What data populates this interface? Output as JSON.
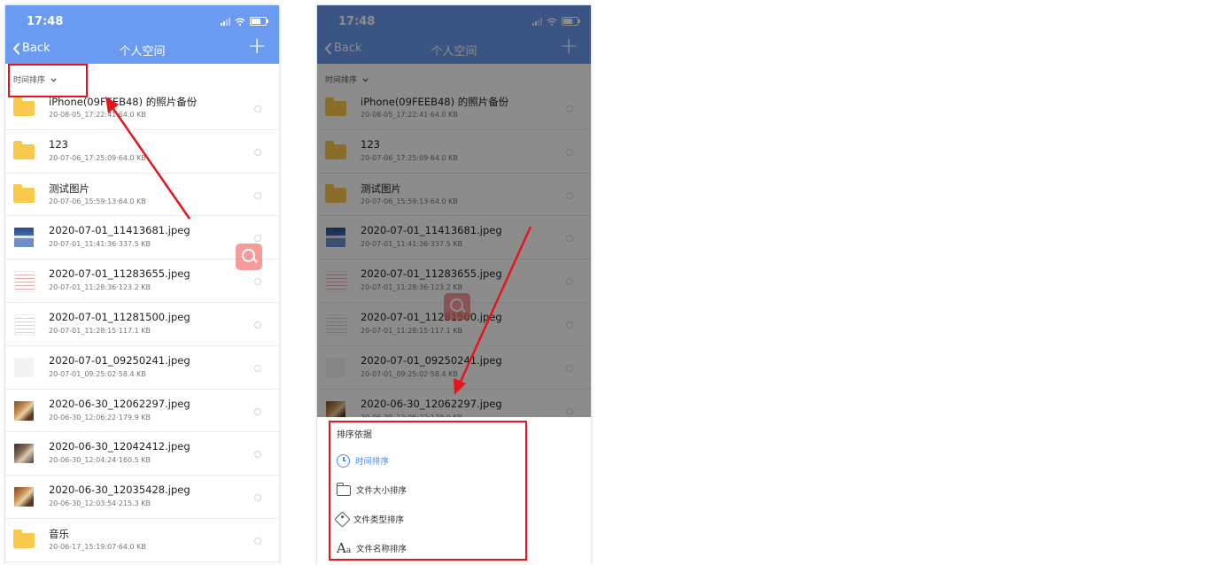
{
  "status": {
    "time": "17:48"
  },
  "nav": {
    "back": "Back",
    "title": "个人空间",
    "add": "+"
  },
  "sort_label": "时间排序",
  "files": [
    {
      "name": "iPhone(09FEEB48) 的照片备份",
      "meta": "20-08-05_17:22:41·64.0 KB",
      "icon": "folder-icon",
      "thumb": "folder"
    },
    {
      "name": "123",
      "meta": "20-07-06_17:25:09·64.0 KB",
      "icon": "folder-icon",
      "thumb": "folder"
    },
    {
      "name": "测试图片",
      "meta": "20-07-06_15:59:13·64.0 KB",
      "icon": "folder-icon",
      "thumb": "folder"
    },
    {
      "name": "2020-07-01_11413681.jpeg",
      "meta": "20-07-01_11:41:36·337.5 KB",
      "icon": "image-thumbnail",
      "thumb": "screen"
    },
    {
      "name": "2020-07-01_11283655.jpeg",
      "meta": "20-07-01_11:28:36·123.2 KB",
      "icon": "image-thumbnail",
      "thumb": "doc-red"
    },
    {
      "name": "2020-07-01_11281500.jpeg",
      "meta": "20-07-01_11:28:15·117.1 KB",
      "icon": "image-thumbnail",
      "thumb": "doc"
    },
    {
      "name": "2020-07-01_09250241.jpeg",
      "meta": "20-07-01_09:25:02·58.4 KB",
      "icon": "image-thumbnail",
      "thumb": "plain"
    },
    {
      "name": "2020-06-30_12062297.jpeg",
      "meta": "20-06-30_12:06:22·179.9 KB",
      "icon": "image-thumbnail",
      "thumb": "food"
    },
    {
      "name": "2020-06-30_12042412.jpeg",
      "meta": "20-06-30_12:04:24·160.5 KB",
      "icon": "image-thumbnail",
      "thumb": "photo"
    },
    {
      "name": "2020-06-30_12035428.jpeg",
      "meta": "20-06-30_12:03:54·215.3 KB",
      "icon": "image-thumbnail",
      "thumb": "food"
    },
    {
      "name": "音乐",
      "meta": "20-06-17_15:19:07·64.0 KB",
      "icon": "folder-icon",
      "thumb": "folder"
    }
  ],
  "sort_sheet": {
    "title": "排序依据",
    "options": [
      {
        "label": "时间排序",
        "icon": "clock-icon",
        "active": true
      },
      {
        "label": "文件大小排序",
        "icon": "folder-outline-icon",
        "active": false
      },
      {
        "label": "文件类型排序",
        "icon": "tag-icon",
        "active": false
      },
      {
        "label": "文件名称排序",
        "icon": "text-aa-icon",
        "active": false
      }
    ]
  },
  "colors": {
    "header": "#6a9bf0",
    "header_dim": "#3a5586",
    "folder": "#f8c94a",
    "accent": "#4a8ae8",
    "annotation": "#e8141b"
  }
}
